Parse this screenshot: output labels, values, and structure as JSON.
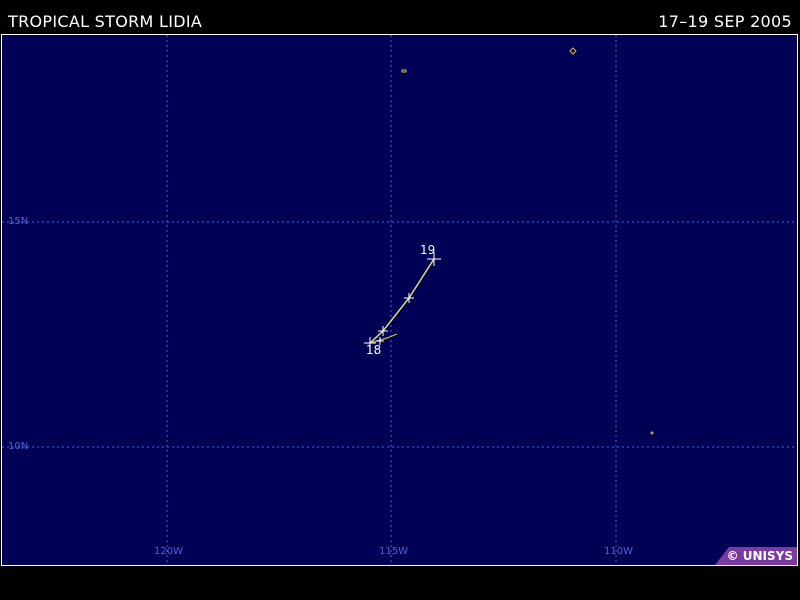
{
  "header": {
    "title": "TROPICAL STORM LIDIA",
    "dates": "17–19 SEP 2005"
  },
  "map": {
    "longitude_labels": [
      "120W",
      "115W",
      "110W"
    ],
    "latitude_labels": [
      "15N",
      "10N"
    ],
    "day_labels": [
      "18",
      "19"
    ],
    "track_color": "#e0e070",
    "ocean_color": "#000055",
    "grid_color": "#4a62d8"
  },
  "credit": "© UNISYS"
}
